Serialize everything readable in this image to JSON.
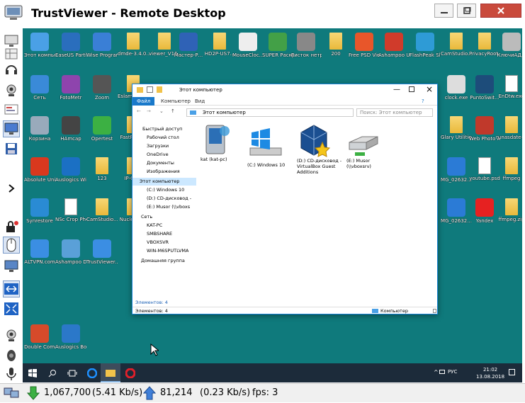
{
  "window": {
    "title": "TrustViewer - Remote Desktop"
  },
  "desktop_icons": [
    {
      "label": "Этот компьютер",
      "icon": "computer-icon"
    },
    {
      "label": "EaseUS Partition...",
      "icon": "partition-icon"
    },
    {
      "label": "Wise Program...",
      "icon": "wise-icon"
    },
    {
      "label": "dmde-3.4.0...",
      "icon": "folder-icon"
    },
    {
      "label": "viewer_V16...",
      "icon": "folder-icon"
    },
    {
      "label": "Мастер-Р...",
      "icon": "app-icon"
    },
    {
      "label": "HD2P-US7...",
      "icon": "folder-icon"
    },
    {
      "label": "MouseCloc...",
      "icon": "clock-cursor-icon"
    },
    {
      "label": "SUPER Раскраска",
      "icon": "bug-icon"
    },
    {
      "label": "Листок нетрудосп...",
      "icon": "printer-icon"
    },
    {
      "label": "200",
      "icon": "folder-icon"
    },
    {
      "label": "Free PSD Viewer",
      "icon": "psd-icon"
    },
    {
      "label": "Ashampoo UnInstaller 6",
      "icon": "ashampoo-icon"
    },
    {
      "label": "FlashPeak SlimBrowser",
      "icon": "browser-icon"
    },
    {
      "label": "CamStudio...",
      "icon": "folder-icon"
    },
    {
      "label": "PrivacyRoot Software",
      "icon": "folder-icon"
    },
    {
      "label": "КлючиАД...",
      "icon": "shield-icon"
    },
    {
      "label": "Сеть",
      "icon": "network-icon"
    },
    {
      "label": "FotoMetr",
      "icon": "fotometr-icon"
    },
    {
      "label": "Zoom",
      "icon": "binoculars-icon"
    },
    {
      "label": "Eslam Assista...",
      "icon": "folder-icon"
    },
    {
      "label": "clock.exe",
      "icon": "clock-icon"
    },
    {
      "label": "PuntoSwit...",
      "icon": "punto-icon"
    },
    {
      "label": "EnDtw.exe",
      "icon": "doc-icon"
    },
    {
      "label": "Корзина",
      "icon": "recycle-bin-icon"
    },
    {
      "label": "HAmcap",
      "icon": "hamcap-icon"
    },
    {
      "label": "Opertest",
      "icon": "check-icon"
    },
    {
      "label": "FastReSt...",
      "icon": "folder-icon"
    },
    {
      "label": "Glary Utilities_P...",
      "icon": "folder-icon"
    },
    {
      "label": "Web Photo Album",
      "icon": "photo-album-icon"
    },
    {
      "label": "runasdate-...",
      "icon": "folder-icon"
    },
    {
      "label": "Absolute Uninstaller",
      "icon": "uninstaller-icon"
    },
    {
      "label": "Auslogics Windows...",
      "icon": "auslogics-icon"
    },
    {
      "label": "123",
      "icon": "folder-icon"
    },
    {
      "label": "IP-Chat",
      "icon": "folder-icon"
    },
    {
      "label": "MG_02632...",
      "icon": "image-icon"
    },
    {
      "label": "youtube.psd",
      "icon": "doc-icon"
    },
    {
      "label": "ffmpeg",
      "icon": "folder-icon"
    },
    {
      "label": "Synrestore",
      "icon": "synrestore-icon"
    },
    {
      "label": "NSc Crop Photo",
      "icon": "doc-icon"
    },
    {
      "label": "CamStudio...",
      "icon": "folder-icon"
    },
    {
      "label": "NuclearB...",
      "icon": "folder-icon"
    },
    {
      "label": "MG_02632...",
      "icon": "image-icon"
    },
    {
      "label": "Yandex",
      "icon": "yandex-icon"
    },
    {
      "label": "ffmpeg.zip",
      "icon": "zip-icon"
    },
    {
      "label": "ALTVPN.com",
      "icon": "globe-icon"
    },
    {
      "label": "Ashampoo Deals",
      "icon": "deals-icon"
    },
    {
      "label": "TrustViewer...",
      "icon": "globe-icon"
    },
    {
      "label": "Double Commander",
      "icon": "double-commander-icon"
    },
    {
      "label": "Auslogics BoostSpe...",
      "icon": "boostspeed-icon"
    }
  ],
  "explorer": {
    "title": "Этот компьютер",
    "tabs": [
      "Файл",
      "Компьютер",
      "Вид"
    ],
    "address": "Этот компьютер",
    "search_placeholder": "Поиск: Этот компьютер",
    "sidebar": [
      "Быстрый доступ",
      "Рабочий стол",
      "Загрузки",
      "OneDrive",
      "Документы",
      "Изображения",
      "Этот компьютер",
      "(C:) Windows 10",
      "(D:) CD-дисковод -",
      "(E:) Musor (\\\\vboxs",
      "Сеть",
      "KAT-PC",
      "SMBSHARE",
      "VBOXSVR",
      "WIN-M6SPUTLVMA",
      "Домашняя группа"
    ],
    "drives": [
      {
        "label": "kat (kat-pc)",
        "icon": "network-drive-icon"
      },
      {
        "label": "(C:) Windows 10",
        "icon": "windows-drive-icon"
      },
      {
        "label": "(D:) CD-дисковод - VirtualBox Guest Additions",
        "icon": "virtualbox-cd-icon"
      },
      {
        "label": "(E:) Musor (\\\\vboxsrv)",
        "icon": "network-share-icon"
      }
    ],
    "item_count_top": "Элементов: 4",
    "item_count_bottom": "Элементов: 4",
    "status_location": "Компьютер"
  },
  "taskbar": {
    "lang": "РУС",
    "time": "21:02",
    "date": "13.08.2018"
  },
  "statusbar": {
    "down_bytes": "1,067,700",
    "down_rate": "(5.41 Kb/s)",
    "up_bytes": "81,214",
    "up_rate": "(0.23 Kb/s)",
    "fps": "fps: 3"
  },
  "colors": {
    "desktop": "#0f7a7c",
    "taskbar": "#1c2b3a",
    "accent": "#1883d7"
  }
}
